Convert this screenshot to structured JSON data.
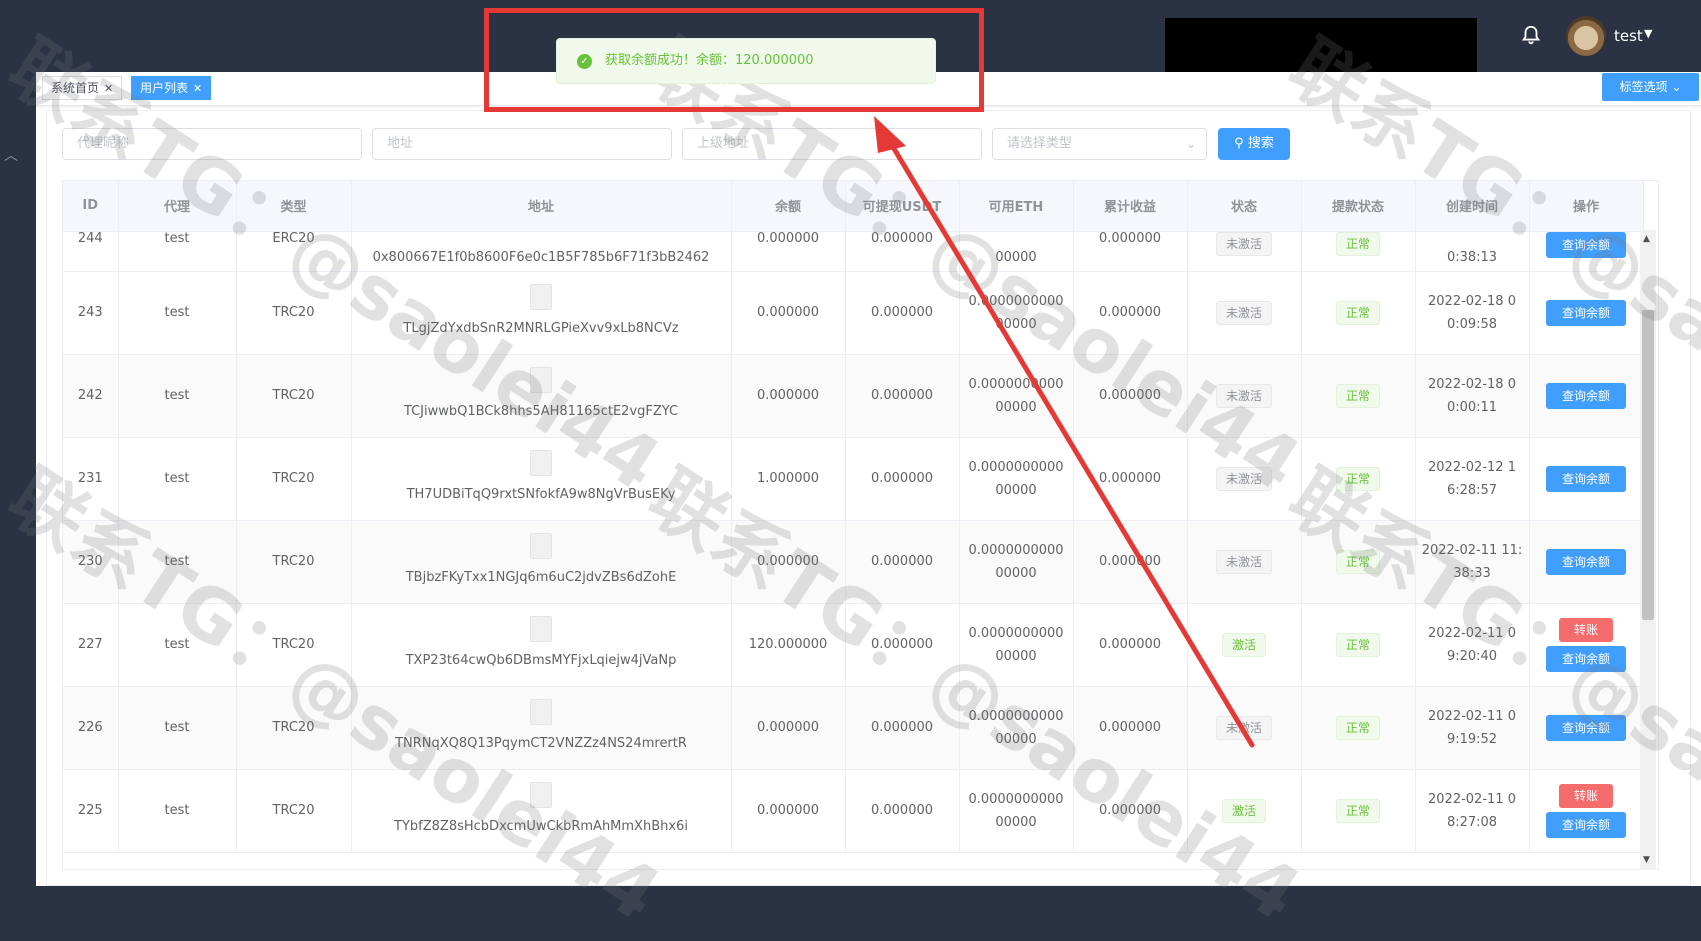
{
  "toast": {
    "message": "获取余额成功！余额：120.000000"
  },
  "header": {
    "user": "test"
  },
  "tags": [
    {
      "label": "系统首页"
    },
    {
      "label": "用户列表"
    }
  ],
  "tag_options": "标签选项",
  "filters": {
    "agent_placeholder": "代理昵称",
    "address_placeholder": "地址",
    "parent_address_placeholder": "上级地址",
    "type_placeholder": "请选择类型",
    "search_label": "搜索"
  },
  "table": {
    "columns": [
      "ID",
      "代理",
      "类型",
      "地址",
      "余额",
      "可提现USDT",
      "可用ETH",
      "累计收益",
      "状态",
      "提款状态",
      "创建时间",
      "操作"
    ],
    "partial_top_row": {
      "id": "244",
      "agent": "test",
      "type": "ERC20",
      "address": "0x800667E1f0b8600F6e0c1B5F785b6F71f3bB2462",
      "balance": "0.000000",
      "withdrawable": "0.000000",
      "eth": "00000",
      "earnings": "0.000000",
      "status": "未激活",
      "withdraw_status": "正常",
      "created": "0:38:13",
      "action": "查询余额"
    },
    "rows": [
      {
        "id": "243",
        "agent": "test",
        "type": "TRC20",
        "address": "TLgjZdYxdbSnR2MNRLGPieXvv9xLb8NCVz",
        "balance": "0.000000",
        "withdrawable": "0.000000",
        "eth_line1": "0.0000000000",
        "eth_line2": "00000",
        "earnings": "0.000000",
        "status": "未激活",
        "withdraw_status": "正常",
        "created_line1": "2022-02-18 0",
        "created_line2": "0:09:58",
        "transfer": "",
        "action": "查询余额"
      },
      {
        "id": "242",
        "agent": "test",
        "type": "TRC20",
        "address": "TCJiwwbQ1BCk8hhs5AH81165ctE2vgFZYC",
        "balance": "0.000000",
        "withdrawable": "0.000000",
        "eth_line1": "0.0000000000",
        "eth_line2": "00000",
        "earnings": "0.000000",
        "status": "未激活",
        "withdraw_status": "正常",
        "created_line1": "2022-02-18 0",
        "created_line2": "0:00:11",
        "transfer": "",
        "action": "查询余额"
      },
      {
        "id": "231",
        "agent": "test",
        "type": "TRC20",
        "address": "TH7UDBiTqQ9rxtSNfokfA9w8NgVrBusEKy",
        "balance": "1.000000",
        "withdrawable": "0.000000",
        "eth_line1": "0.0000000000",
        "eth_line2": "00000",
        "earnings": "0.000000",
        "status": "未激活",
        "withdraw_status": "正常",
        "created_line1": "2022-02-12 1",
        "created_line2": "6:28:57",
        "transfer": "",
        "action": "查询余额"
      },
      {
        "id": "230",
        "agent": "test",
        "type": "TRC20",
        "address": "TBjbzFKyTxx1NGJq6m6uC2jdvZBs6dZohE",
        "balance": "0.000000",
        "withdrawable": "0.000000",
        "eth_line1": "0.0000000000",
        "eth_line2": "00000",
        "earnings": "0.000000",
        "status": "未激活",
        "withdraw_status": "正常",
        "created_line1": "2022-02-11 11:",
        "created_line2": "38:33",
        "transfer": "",
        "action": "查询余额"
      },
      {
        "id": "227",
        "agent": "test",
        "type": "TRC20",
        "address": "TXP23t64cwQb6DBmsMYFjxLqiejw4jVaNp",
        "balance": "120.000000",
        "withdrawable": "0.000000",
        "eth_line1": "0.0000000000",
        "eth_line2": "00000",
        "earnings": "0.000000",
        "status": "激活",
        "withdraw_status": "正常",
        "created_line1": "2022-02-11 0",
        "created_line2": "9:20:40",
        "transfer": "转账",
        "action": "查询余额"
      },
      {
        "id": "226",
        "agent": "test",
        "type": "TRC20",
        "address": "TNRNqXQ8Q13PqymCT2VNZZz4NS24mrertR",
        "balance": "0.000000",
        "withdrawable": "0.000000",
        "eth_line1": "0.0000000000",
        "eth_line2": "00000",
        "earnings": "0.000000",
        "status": "未激活",
        "withdraw_status": "正常",
        "created_line1": "2022-02-11 0",
        "created_line2": "9:19:52",
        "transfer": "",
        "action": "查询余额"
      },
      {
        "id": "225",
        "agent": "test",
        "type": "TRC20",
        "address": "TYbfZ8Z8sHcbDxcmUwCkbRmAhMmXhBhx6i",
        "balance": "0.000000",
        "withdrawable": "0.000000",
        "eth_line1": "0.0000000000",
        "eth_line2": "00000",
        "earnings": "0.000000",
        "status": "激活",
        "withdraw_status": "正常",
        "created_line1": "2022-02-11 0",
        "created_line2": "8:27:08",
        "transfer": "转账",
        "action": "查询余额"
      }
    ]
  },
  "watermark": "联系TG：@saolei44",
  "colors": {
    "primary": "#409eff",
    "danger": "#f56c6c",
    "success": "#67c23a",
    "header_bg": "#2b3243",
    "annotation_red": "#e53935"
  }
}
